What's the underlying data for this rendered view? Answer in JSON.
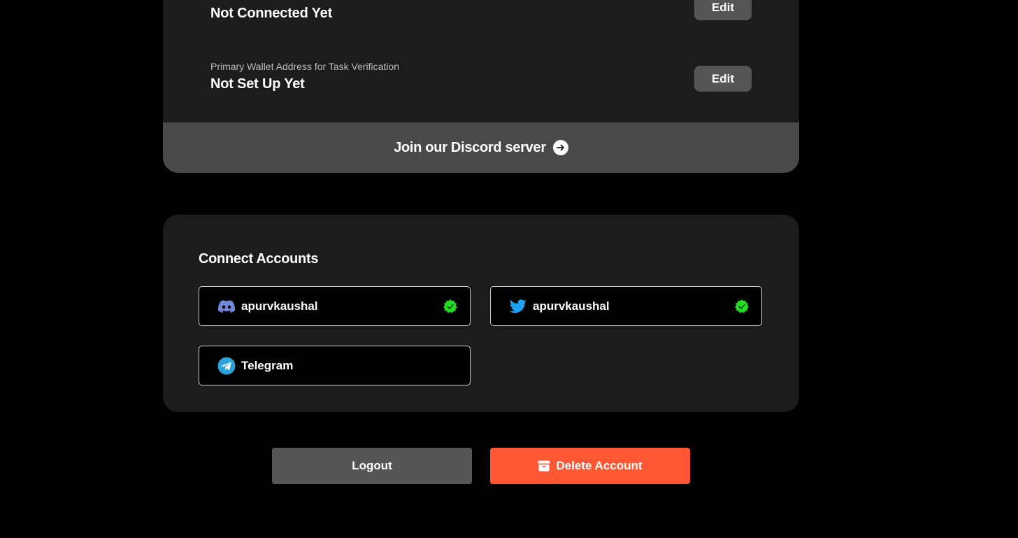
{
  "profile": {
    "fields": [
      {
        "label": "",
        "value": "Not Connected Yet",
        "edit_label": "Edit"
      },
      {
        "label": "Primary Wallet Address for Task Verification",
        "value": "Not Set Up Yet",
        "edit_label": "Edit"
      }
    ],
    "discord_banner": {
      "text": "Join our Discord server",
      "icon": "arrow-right-circle-icon"
    }
  },
  "connect_accounts": {
    "title": "Connect Accounts",
    "accounts": [
      {
        "platform": "discord",
        "icon": "discord-icon",
        "name": "apurvkaushal",
        "verified": true
      },
      {
        "platform": "twitter",
        "icon": "twitter-icon",
        "name": "apurvkaushal",
        "verified": true
      },
      {
        "platform": "telegram",
        "icon": "telegram-icon",
        "name": "Telegram",
        "verified": false
      }
    ]
  },
  "actions": {
    "logout_label": "Logout",
    "delete_label": "Delete Account",
    "delete_icon": "archive-box-icon"
  },
  "colors": {
    "background": "#000000",
    "card": "#1c1c1c",
    "banner": "#494949",
    "button_gray": "#555555",
    "danger": "#ff5733",
    "verified_green": "#22dd22",
    "discord_blurple": "#7289da",
    "twitter_blue": "#1da1f2",
    "telegram_blue": "#2aa3dd"
  }
}
